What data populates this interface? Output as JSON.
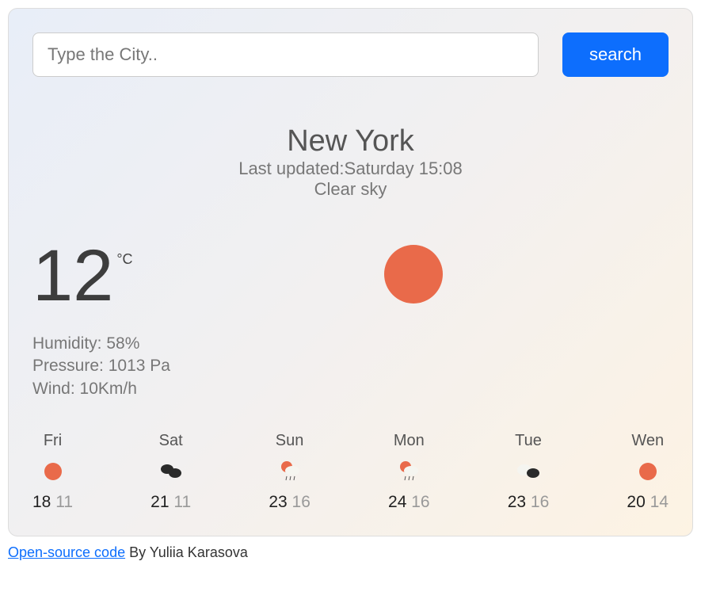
{
  "search": {
    "placeholder": "Type the City..",
    "button_label": "search"
  },
  "current": {
    "city": "New York",
    "last_updated_label": "Last updated:",
    "last_updated_value": "Saturday 15:08",
    "description": "Clear sky",
    "temperature": "12",
    "unit": "°C",
    "humidity_label": "Humidity:",
    "humidity_value": "58%",
    "pressure_label": "Pressure:",
    "pressure_value": "1013 Pa",
    "wind_label": "Wind:",
    "wind_value": "10Km/h",
    "icon": "sun"
  },
  "forecast": [
    {
      "day": "Fri",
      "icon": "sun",
      "max": "18",
      "min": "11"
    },
    {
      "day": "Sat",
      "icon": "clouds-dark",
      "max": "21",
      "min": "11"
    },
    {
      "day": "Sun",
      "icon": "sun-rain",
      "max": "23",
      "min": "16"
    },
    {
      "day": "Mon",
      "icon": "sun-rain",
      "max": "24",
      "min": "16"
    },
    {
      "day": "Tue",
      "icon": "clouds-mixed",
      "max": "23",
      "min": "16"
    },
    {
      "day": "Wen",
      "icon": "sun",
      "max": "20",
      "min": "14"
    }
  ],
  "footer": {
    "link_text": "Open-source code",
    "by_text": " By Yuliia Karasova"
  },
  "colors": {
    "accent": "#0d6efd",
    "sun": "#e96a4a"
  }
}
